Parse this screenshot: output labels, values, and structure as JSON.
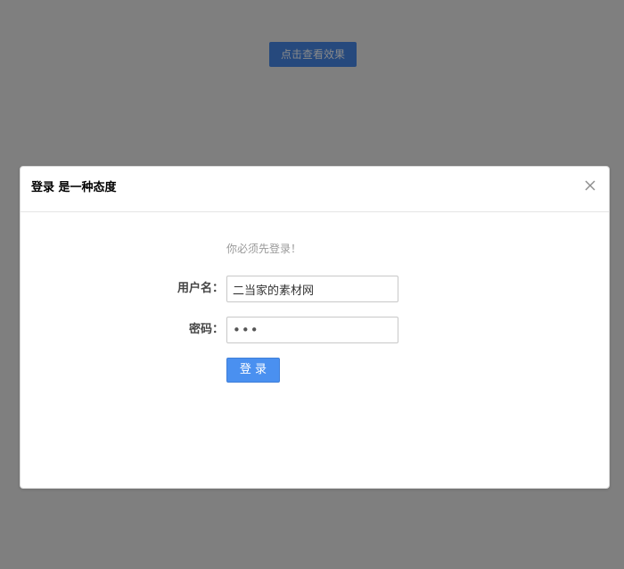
{
  "trigger": {
    "label": "点击查看效果"
  },
  "dialog": {
    "title": "登录 是一种态度",
    "close_icon": "close-icon",
    "notice": "你必须先登录！",
    "username": {
      "label": "用户名：",
      "value": "二当家的素材网"
    },
    "password": {
      "label": "密码：",
      "value": "•••"
    },
    "submit_label": "登 录"
  },
  "colors": {
    "overlay": "#7f7f7f",
    "trigger_bg": "#26497d",
    "primary": "#4a90f0",
    "notice": "#999999"
  }
}
